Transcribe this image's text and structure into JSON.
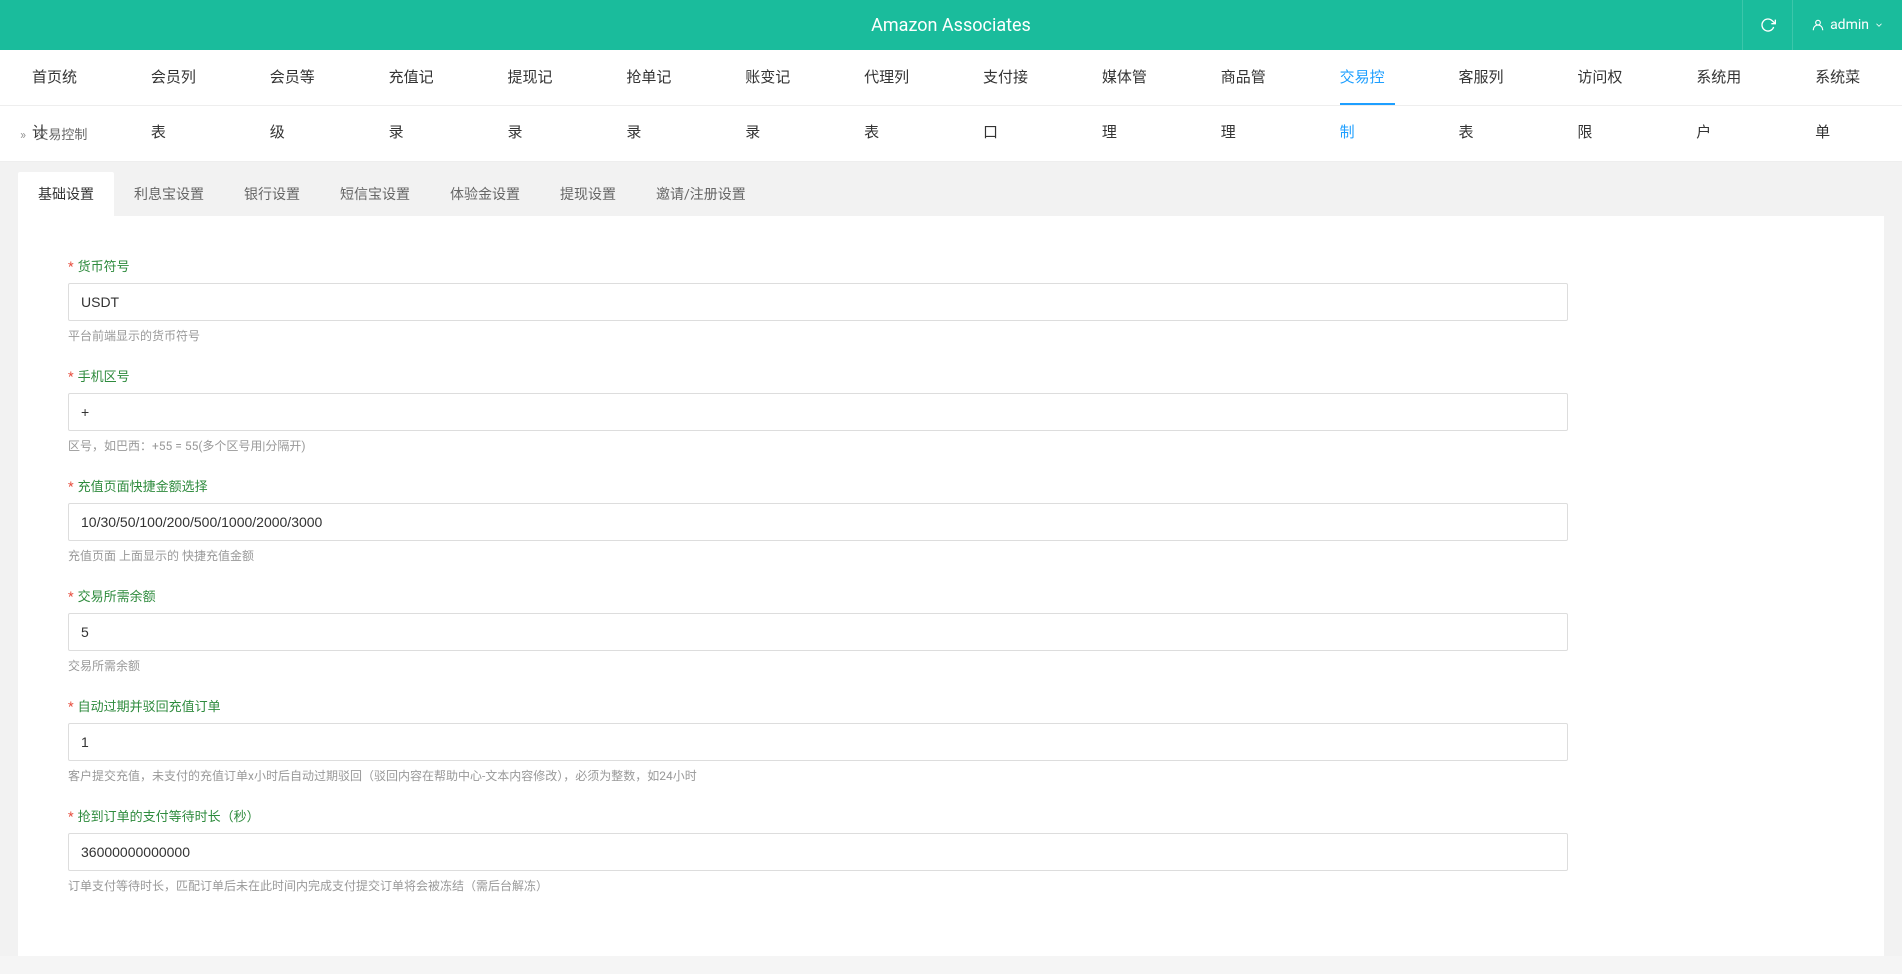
{
  "header": {
    "title": "Amazon Associates",
    "user": "admin"
  },
  "nav": [
    {
      "label": "首页统计"
    },
    {
      "label": "会员列表"
    },
    {
      "label": "会员等级"
    },
    {
      "label": "充值记录"
    },
    {
      "label": "提现记录"
    },
    {
      "label": "抢单记录"
    },
    {
      "label": "账变记录"
    },
    {
      "label": "代理列表"
    },
    {
      "label": "支付接口"
    },
    {
      "label": "媒体管理"
    },
    {
      "label": "商品管理"
    },
    {
      "label": "交易控制",
      "active": true
    },
    {
      "label": "客服列表"
    },
    {
      "label": "访问权限"
    },
    {
      "label": "系统用户"
    },
    {
      "label": "系统菜单"
    }
  ],
  "breadcrumb": {
    "sep": "»",
    "current": "交易控制"
  },
  "tabs": [
    {
      "label": "基础设置",
      "active": true
    },
    {
      "label": "利息宝设置"
    },
    {
      "label": "银行设置"
    },
    {
      "label": "短信宝设置"
    },
    {
      "label": "体验金设置"
    },
    {
      "label": "提现设置"
    },
    {
      "label": "邀请/注册设置"
    }
  ],
  "form": {
    "currency": {
      "label": "货币符号",
      "value": "USDT",
      "hint": "平台前端显示的货币符号"
    },
    "phone_prefix": {
      "label": "手机区号",
      "value": "+",
      "hint": "区号，如巴西：+55 = 55(多个区号用|分隔开)"
    },
    "quick_amounts": {
      "label": "充值页面快捷金额选择",
      "value": "10/30/50/100/200/500/1000/2000/3000",
      "hint": "充值页面 上面显示的 快捷充值金额"
    },
    "trade_balance": {
      "label": "交易所需余额",
      "value": "5",
      "hint": "交易所需余额"
    },
    "auto_expire": {
      "label": "自动过期并驳回充值订单",
      "value": "1",
      "hint": "客户提交充值，未支付的充值订单x小时后自动过期驳回（驳回内容在帮助中心-文本内容修改），必须为整数，如24小时"
    },
    "pay_wait": {
      "label": "抢到订单的支付等待时长（秒）",
      "value": "36000000000000",
      "hint": "订单支付等待时长，匹配订单后未在此时间内完成支付提交订单将会被冻结（需后台解冻）"
    }
  }
}
